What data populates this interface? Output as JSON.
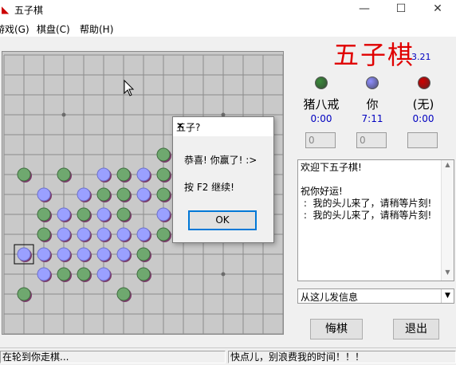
{
  "window": {
    "title": "五子棋",
    "minimize": "—",
    "maximize": "☐",
    "close": "✕"
  },
  "menu": [
    {
      "label": "游戏(G)"
    },
    {
      "label": "棋盘(C)"
    },
    {
      "label": "帮助(H)"
    }
  ],
  "header": {
    "game_title": "五子棋",
    "version": "3.21"
  },
  "players": [
    {
      "name": "猪八戒",
      "time": "0:00",
      "stone_color": "#3a8a3a",
      "field": "0"
    },
    {
      "name": "你",
      "time": "7:11",
      "stone_color": "#8f8fff",
      "field": "0"
    },
    {
      "name": "(无)",
      "time": "0:00",
      "stone_color": "#d00000",
      "field": ""
    }
  ],
  "chat": {
    "lines": "欢迎下五子棋!\n\n祝你好运!\n :  我的头儿来了，请稍等片刻!\n :  我的头儿来了，请稍等片刻!",
    "input_placeholder": "从这儿发信息"
  },
  "buttons": {
    "undo": "悔棋",
    "exit": "退出"
  },
  "status": {
    "left": "在轮到你走棋...",
    "right": "快点儿，别浪费我的时间！！！"
  },
  "dialog": {
    "title": "五子?",
    "message": "恭喜! 你赢了! :>",
    "hint": "按 F2 继续!",
    "ok": "OK"
  },
  "board": {
    "size": 15,
    "grid_color": "#8c8c8c",
    "green_stone": "#6fa86f",
    "blue_stone": "#9aa0ff",
    "stones": [
      {
        "c": 8,
        "r": 5,
        "p": "g"
      },
      {
        "c": 1,
        "r": 6,
        "p": "g"
      },
      {
        "c": 3,
        "r": 6,
        "p": "g"
      },
      {
        "c": 5,
        "r": 6,
        "p": "b"
      },
      {
        "c": 6,
        "r": 6,
        "p": "g"
      },
      {
        "c": 7,
        "r": 6,
        "p": "b"
      },
      {
        "c": 8,
        "r": 6,
        "p": "g"
      },
      {
        "c": 2,
        "r": 7,
        "p": "b"
      },
      {
        "c": 4,
        "r": 7,
        "p": "b"
      },
      {
        "c": 5,
        "r": 7,
        "p": "g"
      },
      {
        "c": 6,
        "r": 7,
        "p": "g"
      },
      {
        "c": 7,
        "r": 7,
        "p": "b"
      },
      {
        "c": 8,
        "r": 7,
        "p": "g"
      },
      {
        "c": 2,
        "r": 8,
        "p": "g"
      },
      {
        "c": 3,
        "r": 8,
        "p": "b"
      },
      {
        "c": 4,
        "r": 8,
        "p": "g"
      },
      {
        "c": 5,
        "r": 8,
        "p": "b"
      },
      {
        "c": 6,
        "r": 8,
        "p": "g"
      },
      {
        "c": 8,
        "r": 8,
        "p": "b"
      },
      {
        "c": 2,
        "r": 9,
        "p": "g"
      },
      {
        "c": 3,
        "r": 9,
        "p": "b"
      },
      {
        "c": 4,
        "r": 9,
        "p": "b"
      },
      {
        "c": 5,
        "r": 9,
        "p": "b"
      },
      {
        "c": 6,
        "r": 9,
        "p": "b"
      },
      {
        "c": 7,
        "r": 9,
        "p": "b"
      },
      {
        "c": 8,
        "r": 9,
        "p": "g"
      },
      {
        "c": 1,
        "r": 10,
        "p": "b",
        "last": true
      },
      {
        "c": 2,
        "r": 10,
        "p": "b"
      },
      {
        "c": 3,
        "r": 10,
        "p": "b"
      },
      {
        "c": 4,
        "r": 10,
        "p": "b"
      },
      {
        "c": 5,
        "r": 10,
        "p": "b"
      },
      {
        "c": 6,
        "r": 10,
        "p": "b"
      },
      {
        "c": 7,
        "r": 10,
        "p": "g"
      },
      {
        "c": 2,
        "r": 11,
        "p": "b"
      },
      {
        "c": 3,
        "r": 11,
        "p": "g"
      },
      {
        "c": 4,
        "r": 11,
        "p": "g"
      },
      {
        "c": 5,
        "r": 11,
        "p": "b"
      },
      {
        "c": 7,
        "r": 11,
        "p": "g"
      },
      {
        "c": 1,
        "r": 12,
        "p": "g"
      },
      {
        "c": 6,
        "r": 12,
        "p": "g"
      }
    ]
  }
}
